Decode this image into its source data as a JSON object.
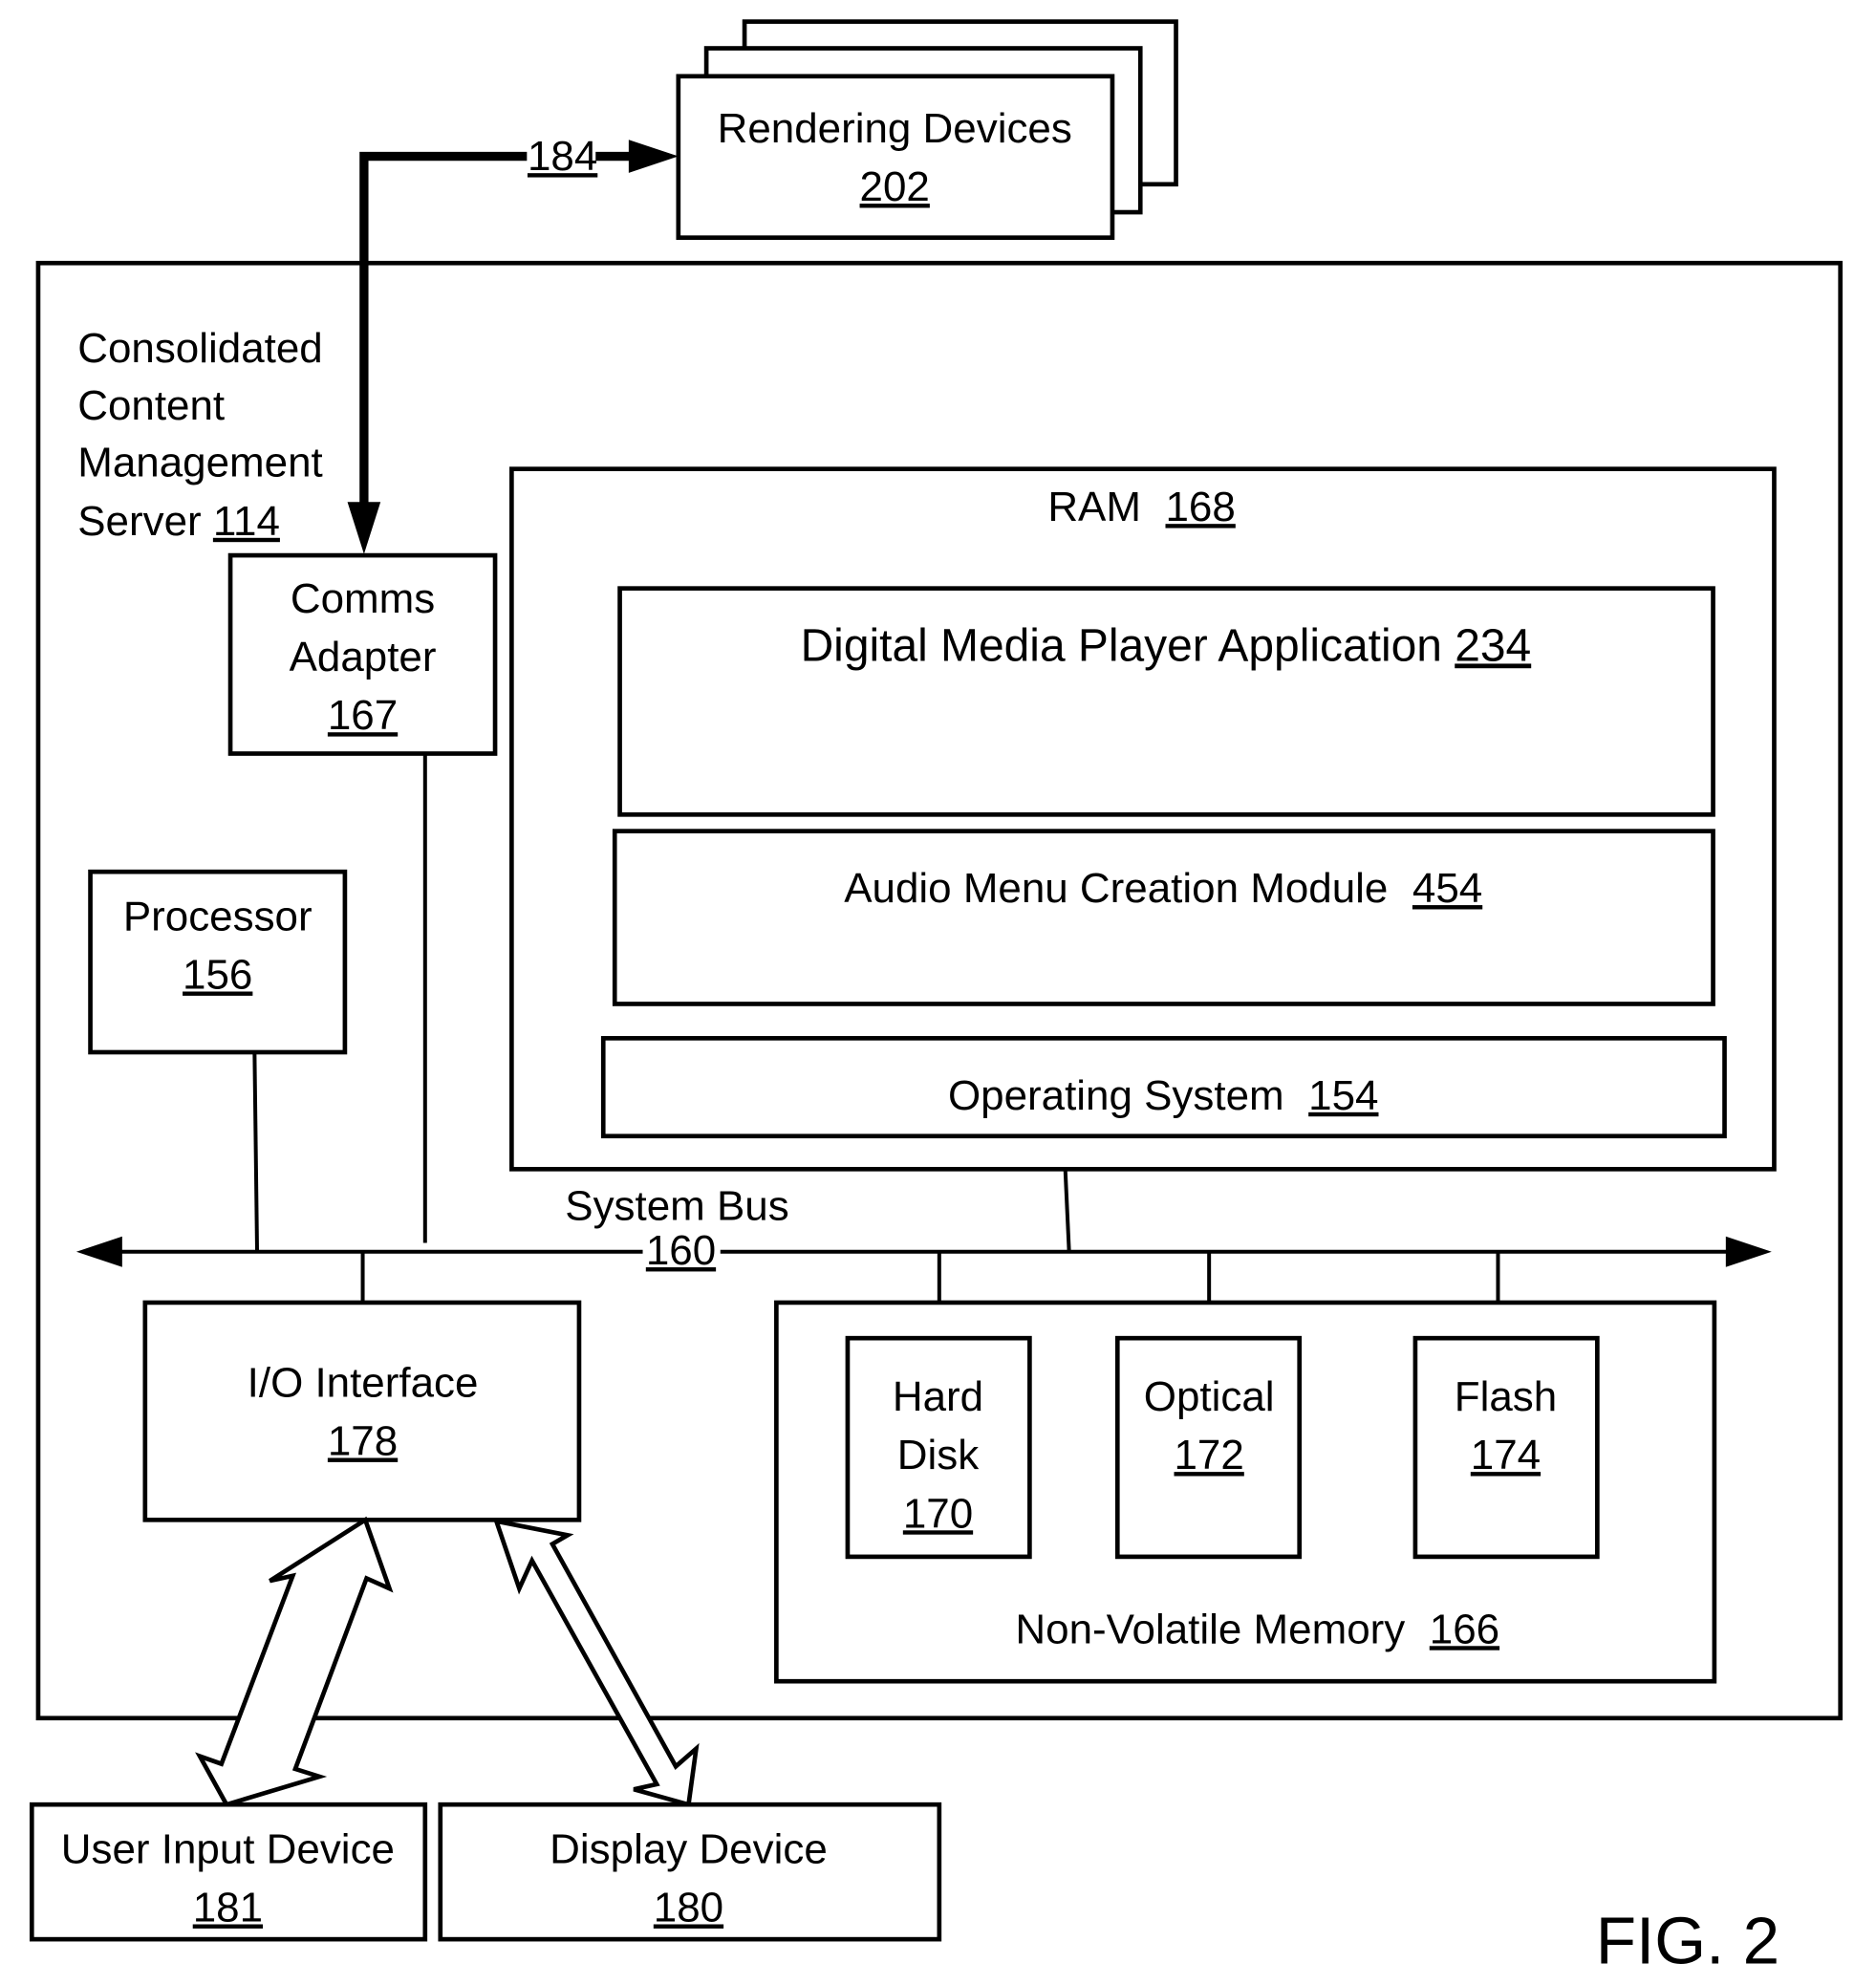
{
  "figure": {
    "label": "FIG. 2",
    "colors": {
      "stroke": "#000000",
      "background": "#ffffff"
    }
  },
  "rendering_devices": {
    "name": "Rendering Devices",
    "ref": "202"
  },
  "link": {
    "ref": "184"
  },
  "server": {
    "lines": [
      "Consolidated",
      "Content",
      "Management",
      "Server"
    ],
    "ref": "114"
  },
  "comms_adapter": {
    "lines": [
      "Comms",
      "Adapter"
    ],
    "ref": "167"
  },
  "ram": {
    "name": "RAM",
    "ref": "168"
  },
  "dmpa": {
    "name": "Digital Media Player Application",
    "ref": "234"
  },
  "audio_menu": {
    "name": "Audio Menu Creation Module",
    "ref": "454"
  },
  "os": {
    "name": "Operating System",
    "ref": "154"
  },
  "processor": {
    "name": "Processor",
    "ref": "156"
  },
  "system_bus": {
    "name": "System Bus",
    "ref": "160"
  },
  "io_interface": {
    "name": "I/O Interface",
    "ref": "178"
  },
  "nvm": {
    "name": "Non-Volatile Memory",
    "ref": "166"
  },
  "hard_disk": {
    "lines": [
      "Hard",
      "Disk"
    ],
    "ref": "170"
  },
  "optical": {
    "name": "Optical",
    "ref": "172"
  },
  "flash": {
    "name": "Flash",
    "ref": "174"
  },
  "user_input": {
    "name": "User Input Device",
    "ref": "181"
  },
  "display": {
    "name": "Display Device",
    "ref": "180"
  }
}
